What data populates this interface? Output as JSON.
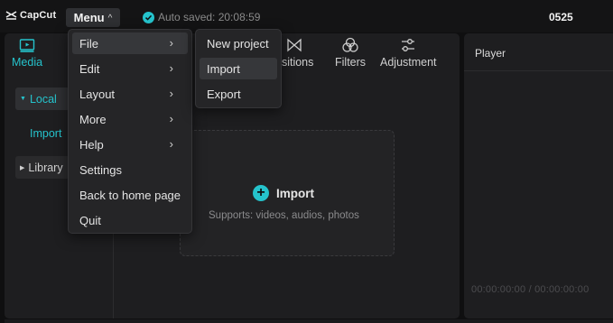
{
  "app": {
    "logo_text": "CapCut",
    "project_name": "0525"
  },
  "menu_button": {
    "label": "Menu",
    "chevron": "^"
  },
  "autosave": {
    "text": "Auto saved: 20:08:59"
  },
  "toolbar": {
    "tabs": [
      {
        "label": "Media",
        "icon": "media-icon",
        "active": true
      },
      {
        "label": "nsitions",
        "icon": "transitions-icon"
      },
      {
        "label": "Filters",
        "icon": "filters-icon"
      },
      {
        "label": "Adjustment",
        "icon": "adjustment-icon"
      }
    ]
  },
  "sidebar": {
    "local": "Local",
    "import": "Import",
    "library": "Library"
  },
  "import_area": {
    "button_label": "Import",
    "supports_text": "Supports: videos, audios, photos"
  },
  "player": {
    "title": "Player",
    "timecode": "00:00:00:00 / 00:00:00:00"
  },
  "main_menu": {
    "items": [
      {
        "label": "File",
        "submenu": true,
        "highlighted": true
      },
      {
        "label": "Edit",
        "submenu": true
      },
      {
        "label": "Layout",
        "submenu": true
      },
      {
        "label": "More",
        "submenu": true
      },
      {
        "label": "Help",
        "submenu": true
      },
      {
        "label": "Settings",
        "submenu": false
      },
      {
        "label": "Back to home page",
        "submenu": false
      },
      {
        "label": "Quit",
        "submenu": false
      }
    ]
  },
  "file_submenu": {
    "items": [
      {
        "label": "New project"
      },
      {
        "label": "Import",
        "highlighted": true
      },
      {
        "label": "Export"
      }
    ]
  },
  "colors": {
    "accent": "#25c3cc",
    "panel": "#1e1e20",
    "background": "#0f0f10"
  }
}
